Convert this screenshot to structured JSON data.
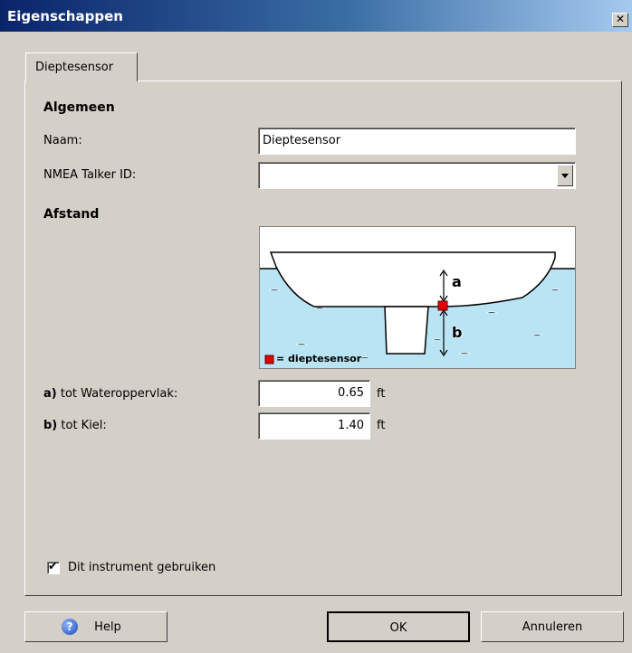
{
  "window": {
    "title": "Eigenschappen",
    "close_glyph": "✕"
  },
  "tabs": [
    {
      "label": "Dieptesensor"
    }
  ],
  "sections": {
    "general": "Algemeen",
    "distance": "Afstand"
  },
  "fields": {
    "name": {
      "label": "Naam:",
      "value": "Dieptesensor"
    },
    "talker_id": {
      "label": "NMEA Talker ID:",
      "value": ""
    },
    "waterline": {
      "prefix": "a)",
      "label": "tot Wateroppervlak:",
      "value": "0.65",
      "unit": "ft"
    },
    "keel": {
      "prefix": "b)",
      "label": "tot Kiel:",
      "value": "1.40",
      "unit": "ft"
    }
  },
  "diagram": {
    "marker_a": "a",
    "marker_b": "b",
    "legend": "= dieptesensor",
    "sensor_color": "#e00000",
    "water_color": "#b9e4f3"
  },
  "use_instrument": {
    "label": "Dit instrument gebruiken",
    "checked": true,
    "mark": "✔"
  },
  "buttons": {
    "help": "Help",
    "help_icon": "?",
    "ok": "OK",
    "cancel": "Annuleren"
  }
}
